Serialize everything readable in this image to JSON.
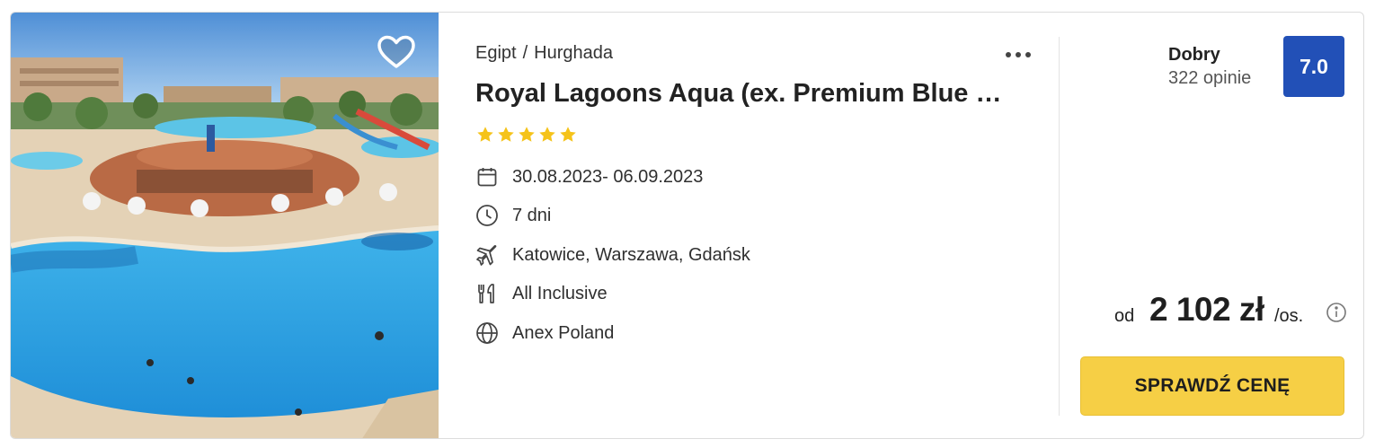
{
  "hotel": {
    "breadcrumb": {
      "country": "Egipt",
      "separator": "/",
      "city": "Hurghada"
    },
    "name": "Royal Lagoons Aqua (ex. Premium Blue Lagoon)",
    "stars": 5,
    "photo_alt": "Hotel pool resort"
  },
  "details": [
    {
      "icon": "calendar-icon",
      "text": "30.08.2023- 06.09.2023"
    },
    {
      "icon": "clock-icon",
      "text": "7 dni"
    },
    {
      "icon": "plane-icon",
      "text": "Katowice, Warszawa, Gdańsk"
    },
    {
      "icon": "cutlery-icon",
      "text": "All Inclusive"
    },
    {
      "icon": "globe-icon",
      "text": "Anex Poland"
    }
  ],
  "rating": {
    "label": "Dobry",
    "count": "322 opinie",
    "score": "7.0",
    "badge_color": "#2250b7"
  },
  "price": {
    "prefix": "od",
    "value": "2 102 zł",
    "unit": "/os."
  },
  "cta": {
    "label": "SPRAWDŹ CENĘ",
    "color": "#f6cf45"
  },
  "icons": {
    "favorite": "heart-icon",
    "more": "more-dots-icon",
    "info": "info-icon",
    "star": "star-icon"
  },
  "colors": {
    "star": "#f5c31a",
    "text": "#2b2b2b",
    "border": "#dcdcdc"
  }
}
